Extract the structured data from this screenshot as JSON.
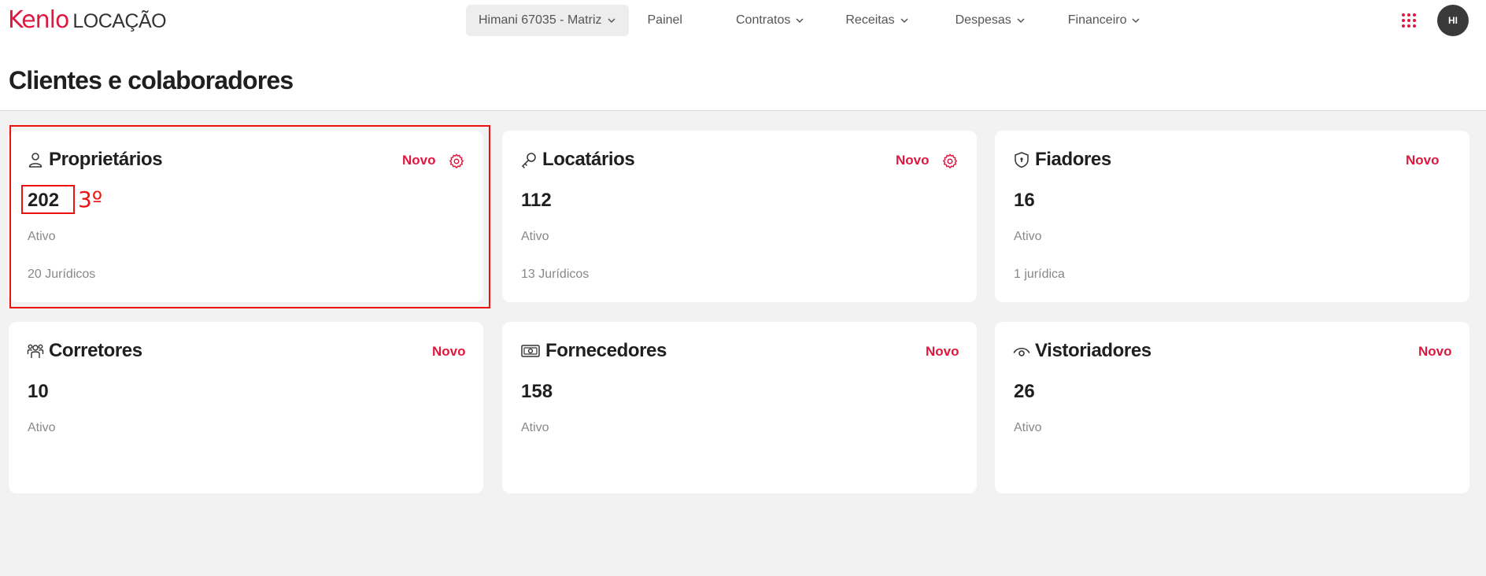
{
  "brand": {
    "name": "Kenlo",
    "product": "LOCAÇÃO"
  },
  "nav": {
    "company": "Himani 67035 - Matriz",
    "items": [
      {
        "label": "Painel",
        "has_dropdown": false
      },
      {
        "label": "Contratos",
        "has_dropdown": true
      },
      {
        "label": "Receitas",
        "has_dropdown": true
      },
      {
        "label": "Despesas",
        "has_dropdown": true
      },
      {
        "label": "Financeiro",
        "has_dropdown": true
      }
    ]
  },
  "user": {
    "initials": "HI"
  },
  "page": {
    "title": "Clientes e colaboradores"
  },
  "cards": [
    {
      "title": "Proprietários",
      "icon": "user-icon",
      "count": "202",
      "status": "Ativo",
      "sub": "20 Jurídicos",
      "new_label": "Novo",
      "has_settings": true
    },
    {
      "title": "Locatários",
      "icon": "key-icon",
      "count": "112",
      "status": "Ativo",
      "sub": "13 Jurídicos",
      "new_label": "Novo",
      "has_settings": true
    },
    {
      "title": "Fiadores",
      "icon": "shield-icon",
      "count": "16",
      "status": "Ativo",
      "sub": "1 jurídica",
      "new_label": "Novo",
      "has_settings": false
    },
    {
      "title": "Corretores",
      "icon": "group-icon",
      "count": "10",
      "status": "Ativo",
      "new_label": "Novo",
      "has_settings": false
    },
    {
      "title": "Fornecedores",
      "icon": "money-icon",
      "count": "158",
      "status": "Ativo",
      "new_label": "Novo",
      "has_settings": false
    },
    {
      "title": "Vistoriadores",
      "icon": "eye-icon",
      "count": "26",
      "status": "Ativo",
      "new_label": "Novo",
      "has_settings": false
    }
  ],
  "annotation": {
    "label": "3º"
  },
  "colors": {
    "accent": "#e0173f",
    "annotation": "#ee1111",
    "background": "#f2f2f2",
    "avatar": "#3a3a3a"
  }
}
